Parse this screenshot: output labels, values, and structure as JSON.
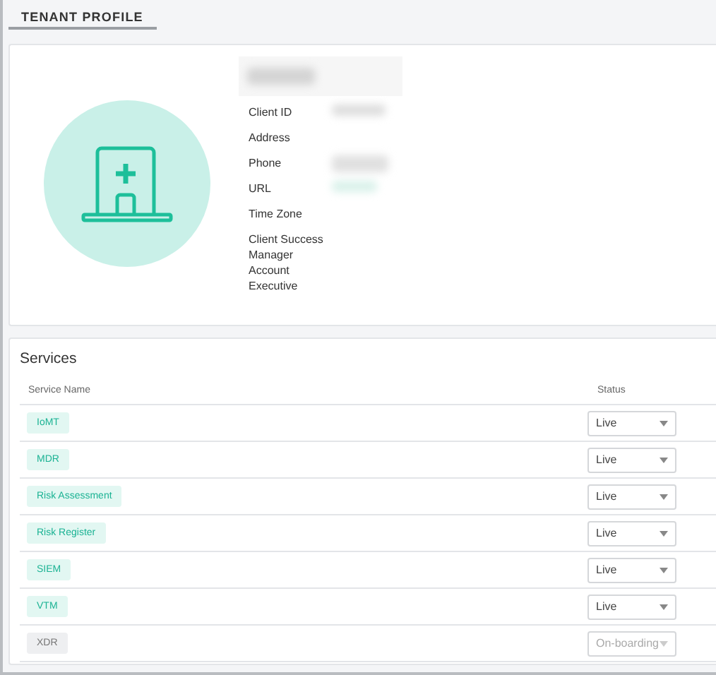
{
  "tabs": [
    {
      "label": "TENANT PROFILE",
      "selected": true
    }
  ],
  "profile": {
    "fields": [
      {
        "label": "Client ID"
      },
      {
        "label": "Address"
      },
      {
        "label": "Phone"
      },
      {
        "label": "URL"
      },
      {
        "label": "Time Zone"
      },
      {
        "label": "Client Success Manager"
      },
      {
        "label": "Account Executive"
      }
    ]
  },
  "services": {
    "title": "Services",
    "columns": [
      "Service Name",
      "Status"
    ],
    "rows": [
      {
        "name": "IoMT",
        "status": "Live",
        "disabled": false
      },
      {
        "name": "MDR",
        "status": "Live",
        "disabled": false
      },
      {
        "name": "Risk Assessment",
        "status": "Live",
        "disabled": false
      },
      {
        "name": "Risk Register",
        "status": "Live",
        "disabled": false
      },
      {
        "name": "SIEM",
        "status": "Live",
        "disabled": false
      },
      {
        "name": "VTM",
        "status": "Live",
        "disabled": false
      },
      {
        "name": "XDR",
        "status": "On-boarding",
        "disabled": true
      }
    ]
  }
}
